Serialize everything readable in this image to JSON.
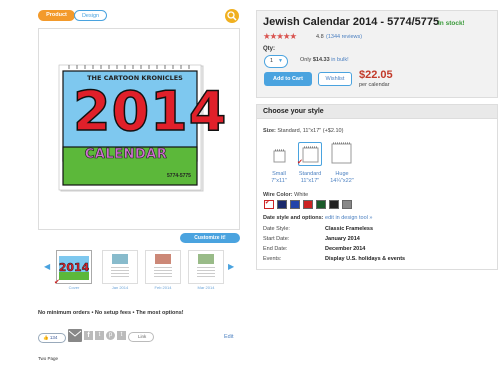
{
  "tabs": {
    "product": "Product",
    "design": "Design"
  },
  "calendar": {
    "banner": "THE CARTOON KRONICLES",
    "year": "2014",
    "word": "CALENDAR",
    "code": "5774-5775"
  },
  "customize": "Customize it!",
  "thumbs": [
    "Cover",
    "Jan 2014",
    "Feb 2014",
    "Mar 2014"
  ],
  "tagline": "No minimum orders • No setup fees • The most options!",
  "social": {
    "like": "Like",
    "count": "134",
    "link": "Link",
    "edit": "Edit"
  },
  "footer": "Two Page",
  "product": {
    "title": "Jewish Calendar 2014 - 5774/5775",
    "stock": "In stock!",
    "rating": "4.8",
    "reviews": "(1344 reviews)",
    "qty_label": "Qty:",
    "qty_value": "1",
    "bulk_text": "Only",
    "bulk_price": "$14.33",
    "bulk_link": "in bulk!",
    "add_to_cart": "Add to Cart",
    "wishlist": "Wishlist",
    "price": "$22.05",
    "price_unit": "per calendar"
  },
  "style": {
    "heading": "Choose your style",
    "size_label": "Size:",
    "size_value": "Standard, 11\"x17\" (+$2.10)",
    "sizes": [
      {
        "name": "Small",
        "dims": "7\"x11\""
      },
      {
        "name": "Standard",
        "dims": "11\"x17\""
      },
      {
        "name": "Huge",
        "dims": "14¼\"x22\""
      }
    ],
    "wire_label": "Wire Color:",
    "wire_value": "White",
    "wire_colors": [
      "#ffffff",
      "#1a2a6c",
      "#2244aa",
      "#cc2222",
      "#1a5a2a",
      "#222222",
      "#888888"
    ],
    "date_opts_label": "Date style and options:",
    "date_opts_link": "edit in design tool »",
    "details": [
      {
        "label": "Date Style:",
        "value": "Classic Frameless"
      },
      {
        "label": "Start Date:",
        "value": "January 2014"
      },
      {
        "label": "End Date:",
        "value": "December 2014"
      },
      {
        "label": "Events:",
        "value": "Display U.S. holidays & events"
      }
    ]
  }
}
